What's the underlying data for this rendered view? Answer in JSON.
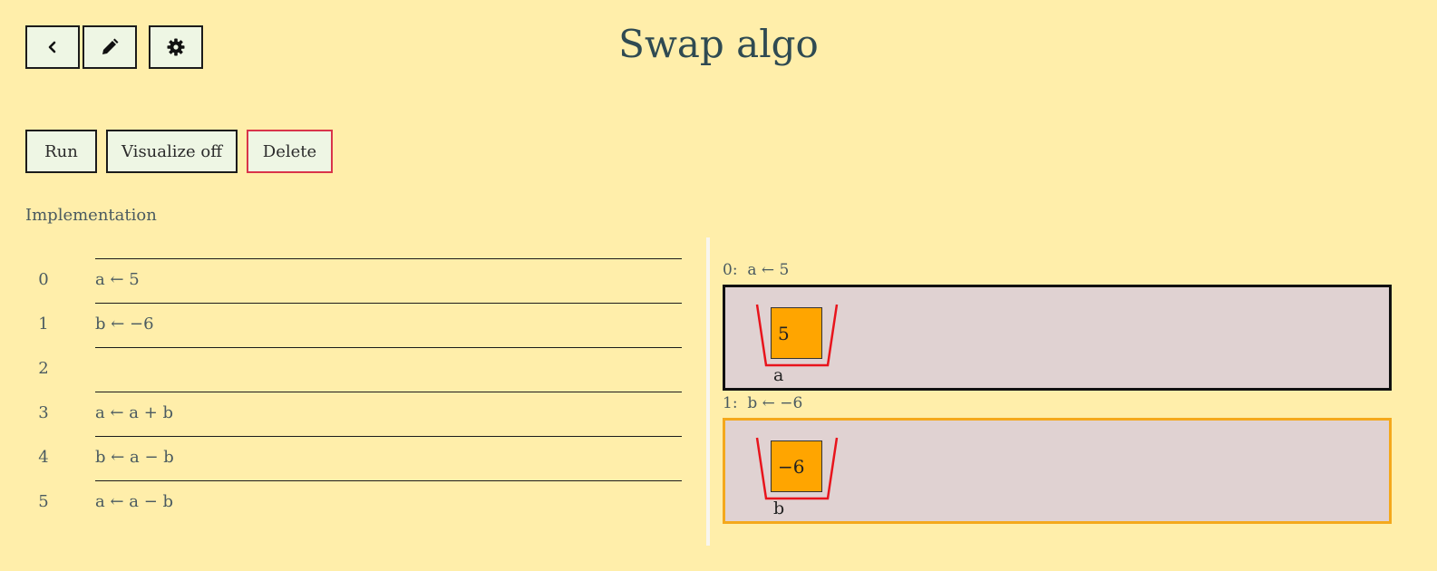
{
  "header": {
    "title": "Swap algo",
    "icons": [
      "chevron-left-icon",
      "pencil-icon",
      "gear-icon"
    ]
  },
  "toolbar": {
    "run_label": "Run",
    "visualize_label": "Visualize off",
    "delete_label": "Delete"
  },
  "implementation": {
    "label": "Implementation",
    "lines": [
      {
        "num": "0",
        "code": "a ← 5"
      },
      {
        "num": "1",
        "code": "b ← −6"
      },
      {
        "num": "2",
        "code": ""
      },
      {
        "num": "3",
        "code": "a ← a + b"
      },
      {
        "num": "4",
        "code": "b ← a − b"
      },
      {
        "num": "5",
        "code": "a ← a − b"
      }
    ]
  },
  "visualization": {
    "steps": [
      {
        "label": "0:  a ← 5",
        "var": "a",
        "value": "5",
        "active": false
      },
      {
        "label": "1:  b ← −6",
        "var": "b",
        "value": "−6",
        "active": true
      }
    ]
  },
  "colors": {
    "background": "#ffeeaa",
    "button_bg": "#eef6e4",
    "danger_border": "#d9344a",
    "viz_bg": "#e0d2d2",
    "active_border": "#f4a81c",
    "cell_fill": "#ffa500",
    "bucket_stroke": "#e8141c"
  }
}
